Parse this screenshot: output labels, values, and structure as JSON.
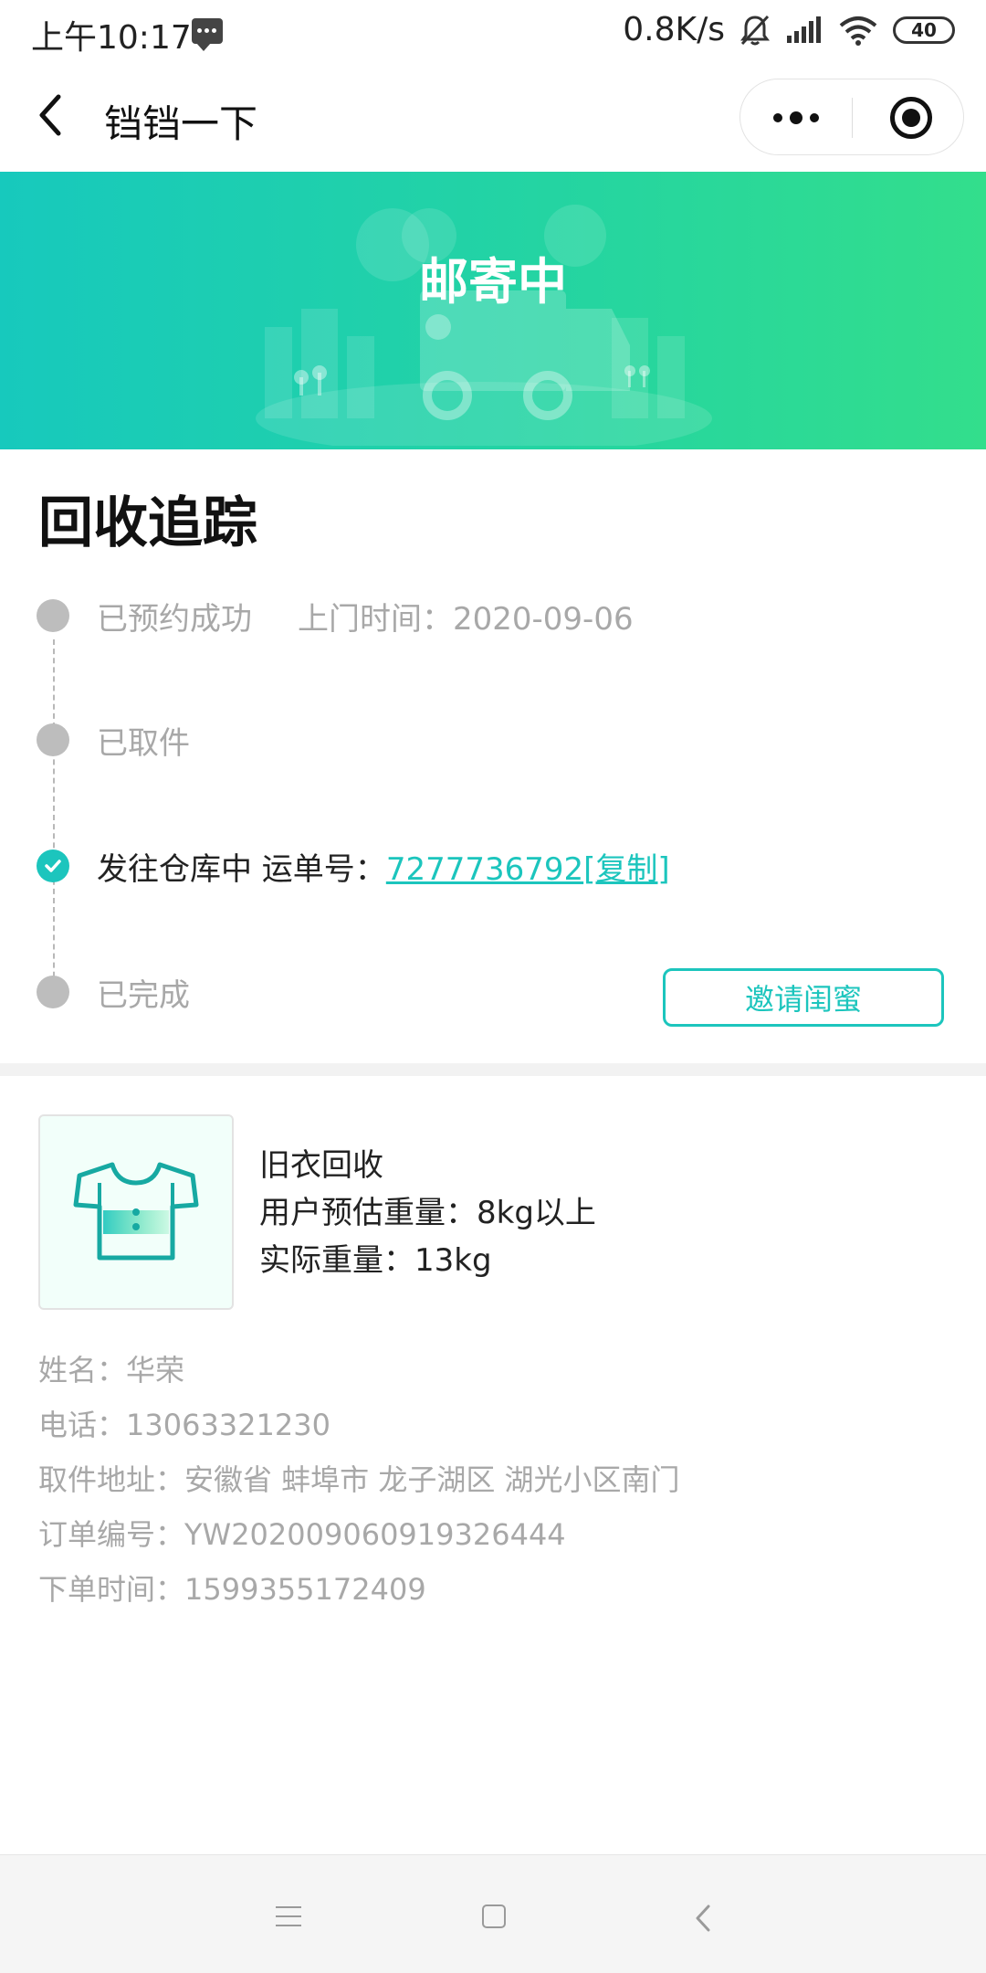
{
  "status_bar": {
    "time": "上午10:17",
    "speed": "0.8K/s",
    "battery": "40"
  },
  "nav": {
    "title": "铛铛一下"
  },
  "banner": {
    "title": "邮寄中"
  },
  "tracking": {
    "title": "回收追踪",
    "steps": [
      {
        "label": "已预约成功",
        "extra": "上门时间：2020-09-06"
      },
      {
        "label": "已取件"
      },
      {
        "label": "发往仓库中 运单号：",
        "tracking_number": "7277736792",
        "copy_label": "[复制]"
      },
      {
        "label": "已完成"
      }
    ],
    "invite_label": "邀请闺蜜"
  },
  "product": {
    "name": "旧衣回收",
    "estimated_weight": "用户预估重量：8kg以上",
    "actual_weight": "实际重量：13kg"
  },
  "info": {
    "name": "姓名：华荣",
    "phone": "电话：13063321230",
    "address": "取件地址：安徽省 蚌埠市 龙子湖区 湖光小区南门",
    "order_no": "订单编号：YW202009060919326444",
    "order_time": "下单时间：1599355172409"
  },
  "colors": {
    "accent": "#1cc5bd",
    "banner_start": "#17c9bd",
    "banner_end": "#33de8c",
    "muted_text": "#a8a8a8"
  },
  "icons": [
    "message-icon",
    "mute-icon",
    "signal-icon",
    "wifi-icon",
    "battery-icon",
    "back-icon",
    "more-icon",
    "close-capsule-icon",
    "check-icon",
    "shirt-icon",
    "menu-icon",
    "home-icon",
    "nav-back-icon"
  ]
}
